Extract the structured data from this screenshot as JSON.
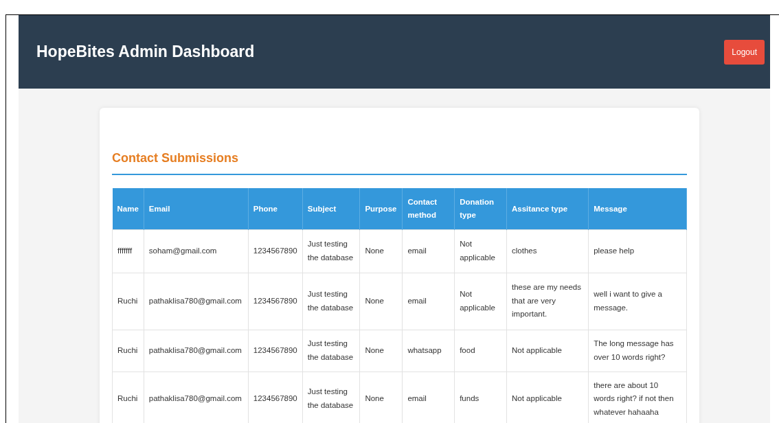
{
  "header": {
    "title": "HopeBites Admin Dashboard",
    "logout_button": "Logout"
  },
  "section": {
    "title": "Contact Submissions"
  },
  "table": {
    "columns": [
      "Name",
      "Email",
      "Phone",
      "Subject",
      "Purpose",
      "Contact method",
      "Donation type",
      "Assitance type",
      "Message"
    ],
    "rows": [
      [
        "fffffff",
        "soham@gmail.com",
        "1234567890",
        "Just testing the database",
        "None",
        "email",
        "Not applicable",
        "clothes",
        "please help"
      ],
      [
        "Ruchi",
        "pathaklisa780@gmail.com",
        "1234567890",
        "Just testing the database",
        "None",
        "email",
        "Not applicable",
        "these are my needs that are very important.",
        "well i want to give a message."
      ],
      [
        "Ruchi",
        "pathaklisa780@gmail.com",
        "1234567890",
        "Just testing the database",
        "None",
        "whatsapp",
        "food",
        "Not applicable",
        "The long message has over 10 words right?"
      ],
      [
        "Ruchi",
        "pathaklisa780@gmail.com",
        "1234567890",
        "Just testing the database",
        "None",
        "email",
        "funds",
        "Not applicable",
        "there are about 10 words right? if not then whatever hahaaha"
      ]
    ]
  }
}
